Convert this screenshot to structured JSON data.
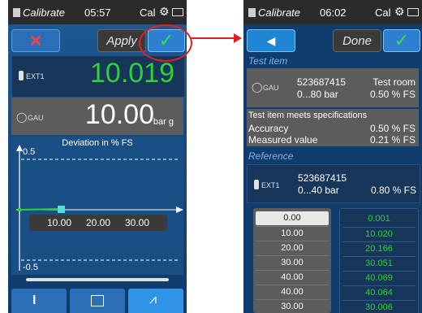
{
  "screen1": {
    "status": {
      "app": "Calibrate",
      "time": "05:57",
      "cal": "Cal"
    },
    "toolbar": {
      "cancel_icon": "cross-icon",
      "apply_label": "Apply",
      "confirm_icon": "check-icon"
    },
    "ext1": {
      "label": "EXT1",
      "value": "10.019"
    },
    "gau": {
      "label": "GAU",
      "value": "10.00",
      "unit": "bar g"
    },
    "chart": {
      "title": "Deviation in % FS",
      "y_top": "0.5",
      "y_bottom": "-0.5",
      "x_ticks": [
        "10.00",
        "20.00",
        "30.00"
      ]
    },
    "tabs": [
      {
        "icon": "instrument-icon"
      },
      {
        "icon": "table-icon"
      },
      {
        "icon": "chart-icon"
      }
    ]
  },
  "screen2": {
    "status": {
      "app": "Calibrate",
      "time": "06:02",
      "cal": "Cal"
    },
    "toolbar": {
      "back_icon": "back-arrow-icon",
      "done_label": "Done",
      "confirm_icon": "check-icon"
    },
    "test_item": {
      "section_title": "Test item",
      "gau_label": "GAU",
      "serial": "523687415",
      "range": "0...80 bar",
      "location": "Test room",
      "accuracy_spec": "0.50 % FS",
      "status_text": "Test item meets specifications",
      "accuracy_label": "Accuracy",
      "accuracy_value": "0.50 % FS",
      "measured_label": "Measured value",
      "measured_value": "0.21 % FS"
    },
    "reference": {
      "section_title": "Reference",
      "ext_label": "EXT1",
      "serial": "523687415",
      "range": "0...40 bar",
      "accuracy": "0.80 % FS"
    },
    "table": {
      "left": [
        "0.00",
        "10.00",
        "20.00",
        "30.00",
        "40.00",
        "40.00",
        "30.00"
      ],
      "right": [
        "0.001",
        "10.020",
        "20.166",
        "30.051",
        "40.069",
        "40.064",
        "30.006"
      ]
    }
  },
  "colors": {
    "accent": "#2fcf3a",
    "primary": "#0f3d6e",
    "callout": "#e02020"
  }
}
